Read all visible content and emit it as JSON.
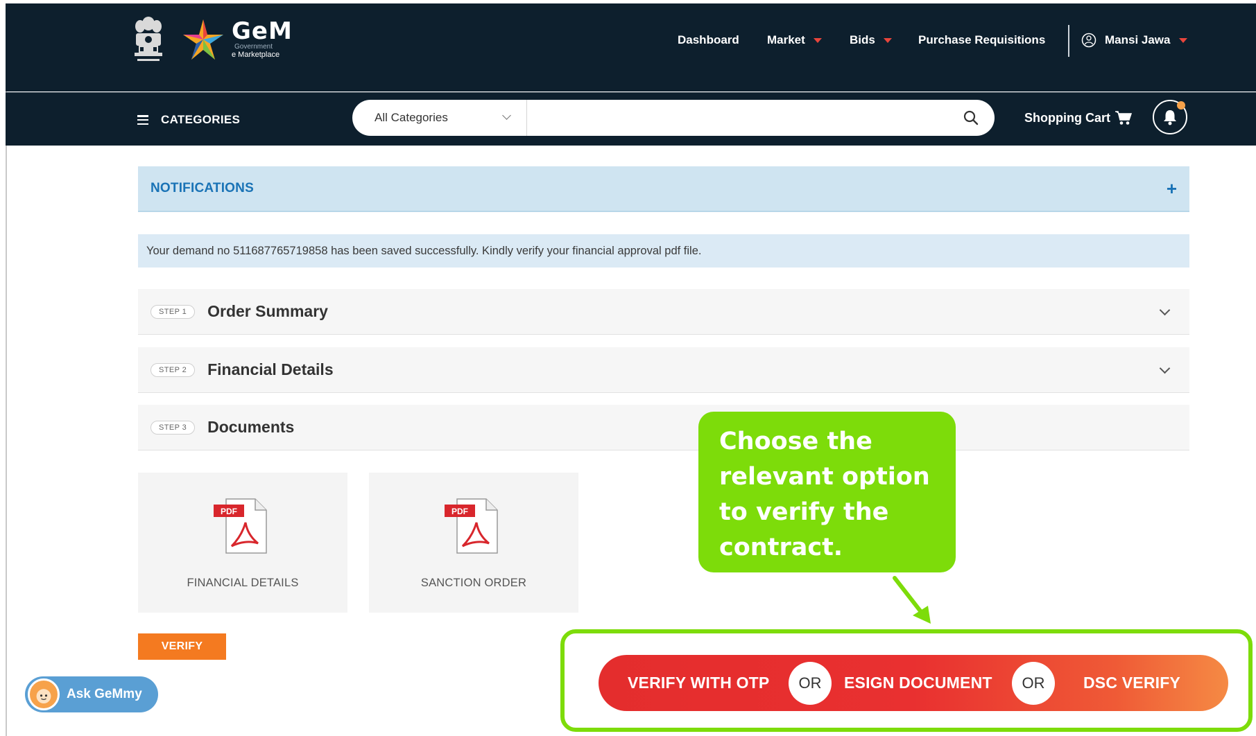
{
  "header": {
    "logo_name": "GeM",
    "logo_line1": "Government",
    "logo_line2": "e Marketplace",
    "nav": {
      "dashboard": "Dashboard",
      "market": "Market",
      "bids": "Bids",
      "purchase_requisitions": "Purchase Requisitions",
      "user": "Mansi Jawa"
    }
  },
  "categories_bar": {
    "menu_label": "CATEGORIES",
    "search_select_value": "All Categories",
    "search_placeholder": "",
    "cart_label": "Shopping Cart"
  },
  "notifications": {
    "title": "NOTIFICATIONS",
    "toggle": "+"
  },
  "alert_message": "Your demand no 511687765719858 has been saved successfully. Kindly verify your financial approval pdf file.",
  "steps": [
    {
      "badge": "STEP 1",
      "label": "Order Summary"
    },
    {
      "badge": "STEP 2",
      "label": "Financial Details"
    },
    {
      "badge": "STEP 3",
      "label": "Documents"
    }
  ],
  "documents": [
    {
      "icon_text": "PDF",
      "label": "FINANCIAL DETAILS"
    },
    {
      "icon_text": "PDF",
      "label": "SANCTION ORDER"
    }
  ],
  "verify_button": "VERIFY",
  "ask_gemmy": "Ask GeMmy",
  "callout": "Choose the relevant option to verify the contract.",
  "verify_options": {
    "otp": "VERIFY WITH OTP",
    "or1": "OR",
    "esign": "ESIGN DOCUMENT",
    "or2": "OR",
    "dsc": "DSC VERIFY"
  },
  "colors": {
    "header_bg": "#0d1f2d",
    "accent_orange": "#f47a20",
    "callout_green": "#7ddc0a",
    "notif_blue": "#1a73b6"
  }
}
